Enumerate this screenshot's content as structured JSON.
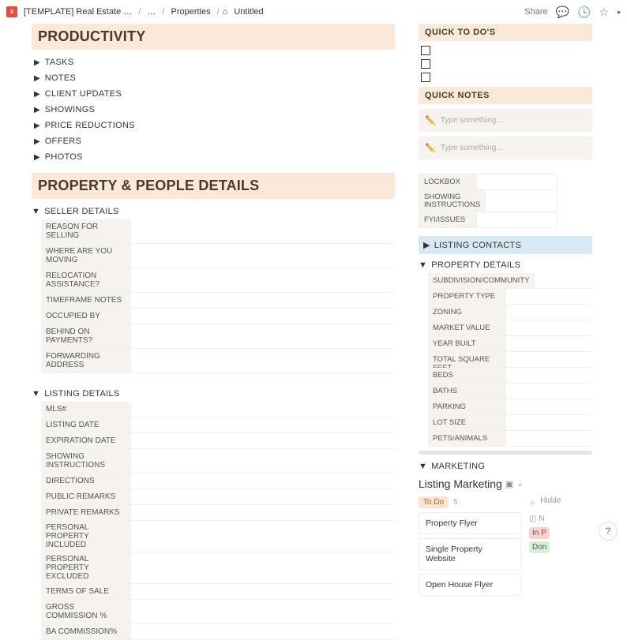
{
  "breadcrumb": {
    "logo": "2",
    "seg1": "[TEMPLATE] Real Estate …",
    "seg2": "…",
    "seg3": "Properties",
    "seg4": "Untitled"
  },
  "topbar": {
    "share": "Share"
  },
  "sections": {
    "productivity": "PRODUCTIVITY",
    "property": "PROPERTY & PEOPLE DETAILS",
    "quicktodo": "QUICK TO DO'S",
    "quicknotes": "QUICK NOTES"
  },
  "prod": {
    "tasks": "TASKS",
    "notes": "NOTES",
    "client": "CLIENT UPDATES",
    "showings": "SHOWINGS",
    "price": "PRICE REDUCTIONS",
    "offers": "OFFERS",
    "photos": "PHOTOS"
  },
  "seller": {
    "title": "SELLER DETAILS",
    "rows": [
      "REASON FOR SELLING",
      "WHERE ARE YOU MOVING",
      "RELOCATION ASSISTANCE?",
      "TIMEFRAME NOTES",
      "OCCUPIED BY",
      "BEHIND ON PAYMENTS?",
      "FORWARDING ADDRESS"
    ]
  },
  "listing": {
    "title": "LISTING DETAILS",
    "rows": [
      "MLS#",
      "LISTING DATE",
      "EXPIRATION DATE",
      "SHOWING INSTRUCTIONS",
      "DIRECTIONS",
      "PUBLIC REMARKS",
      "PRIVATE REMARKS",
      "PERSONAL PROPERTY INCLUDED",
      "PERSONAL PROPERTY EXCLUDED",
      "TERMS OF SALE",
      "GROSS COMMISSION %",
      "BA COMMISSION%"
    ]
  },
  "qnplaceholder": "Type something…",
  "sideinfo": {
    "rows": [
      "LOCKBOX",
      "SHOWING INSTRUCTIONS",
      "FYI/ISSUES"
    ]
  },
  "listingcontacts": "LISTING CONTACTS",
  "propdetails": {
    "title": "PROPERTY DETAILS",
    "rows": [
      "SUBDIVISION/COMMUNITY",
      "PROPERTY TYPE",
      "ZONING",
      "MARKET VALUE",
      "YEAR BUILT",
      "TOTAL SQUARE FEET",
      "BEDS",
      "BATHS",
      "PARKING",
      "LOT SIZE",
      "PETS/ANIMALS"
    ]
  },
  "marketing": {
    "title": "MARKETING",
    "listing": "Listing Marketing",
    "todo": "To Do",
    "todocount": "5",
    "cards": [
      "Property Flyer",
      "Single Property Website",
      "Open House Flyer"
    ],
    "hidden": "Hidde",
    "n": "N",
    "inp": "In P",
    "don": "Don"
  }
}
